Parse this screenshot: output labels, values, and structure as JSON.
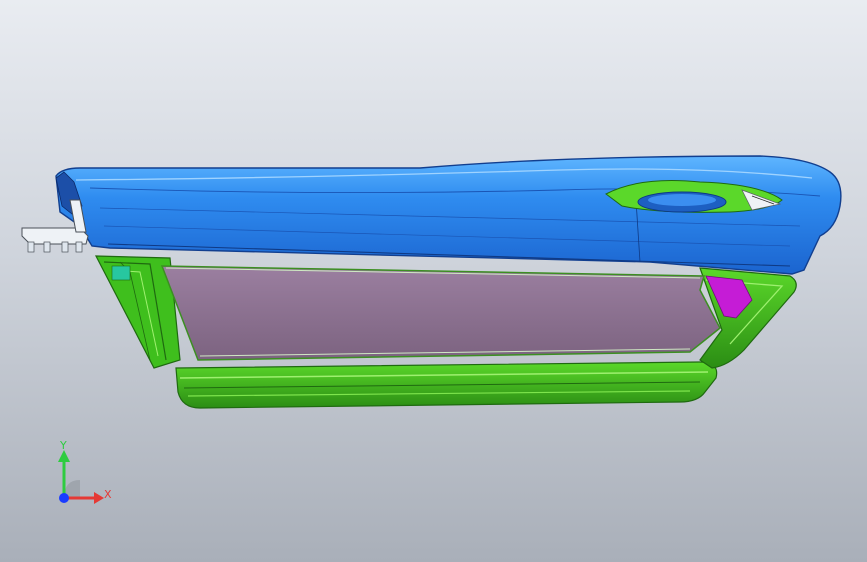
{
  "viewport": {
    "triad": {
      "x_label": "X",
      "y_label": "Y",
      "x_color": "#e53935",
      "y_color": "#2ecc40",
      "origin_color": "#1a3cff"
    }
  },
  "model": {
    "colors": {
      "outer_panel": "#1f7be3",
      "outer_panel_highlight": "#45a6ff",
      "frame": "#3fbf1d",
      "frame_dark": "#1f6a10",
      "glass": "#8a6e8c",
      "accent": "#c51cd6",
      "bracket": "#dfe6ee"
    }
  }
}
